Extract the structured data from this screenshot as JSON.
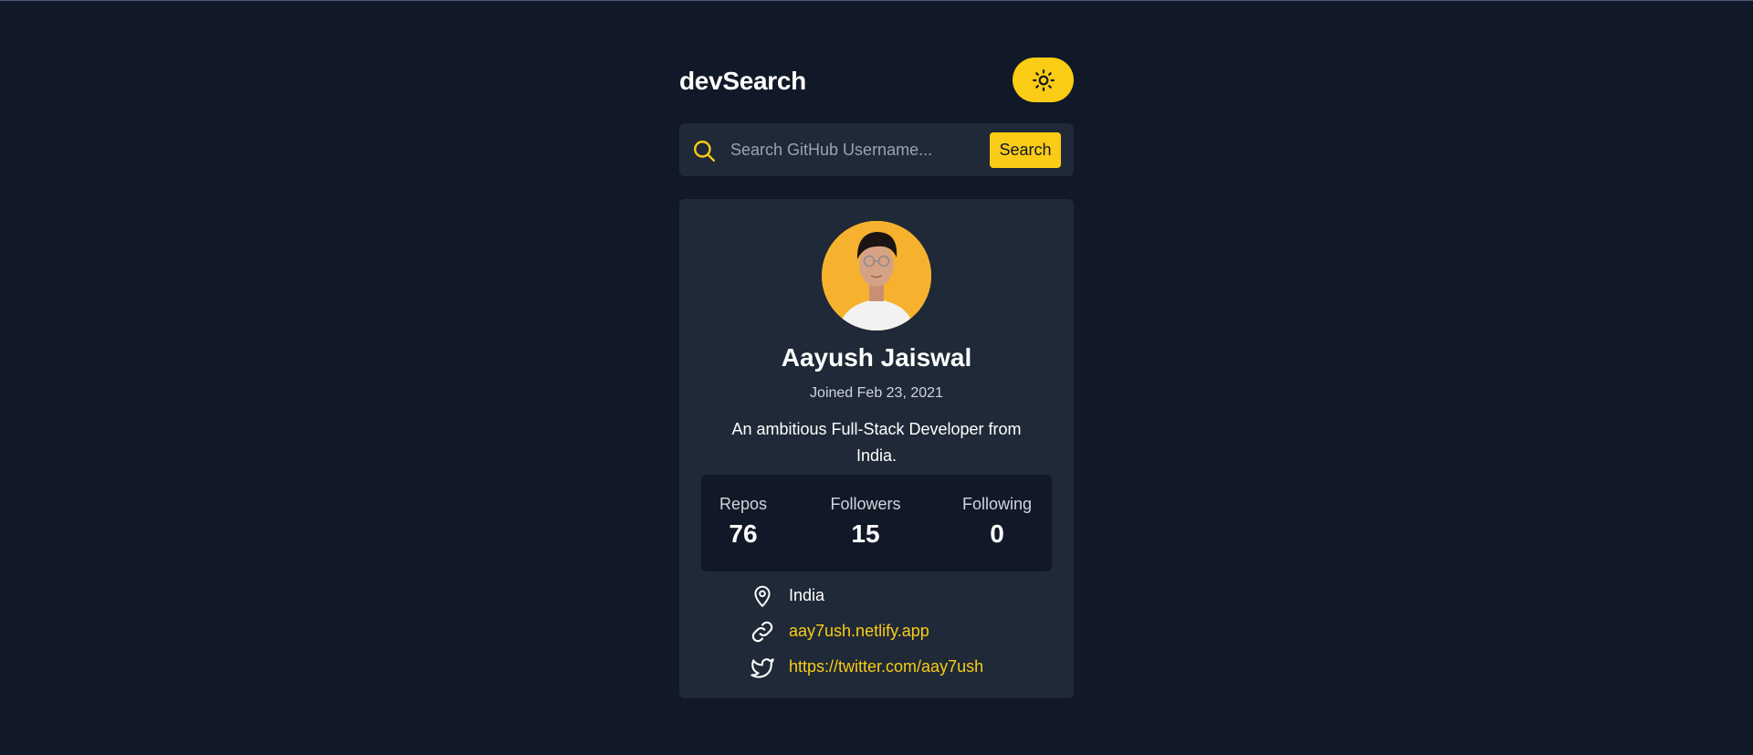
{
  "header": {
    "brand": "devSearch",
    "theme_toggle_icon": "sun-icon"
  },
  "search": {
    "placeholder": "Search GitHub Username...",
    "value": "",
    "button_label": "Search",
    "icon": "search-icon"
  },
  "profile": {
    "avatar": "avatar",
    "name": "Aayush Jaiswal",
    "joined": "Joined Feb 23, 2021",
    "bio": "An ambitious Full-Stack Developer from India."
  },
  "stats": [
    {
      "label": "Repos",
      "value": "76"
    },
    {
      "label": "Followers",
      "value": "15"
    },
    {
      "label": "Following",
      "value": "0"
    }
  ],
  "links": {
    "location": {
      "icon": "map-pin-icon",
      "text": "India"
    },
    "website": {
      "icon": "link-icon",
      "text": "aay7ush.netlify.app"
    },
    "twitter": {
      "icon": "twitter-icon",
      "text": "https://twitter.com/aay7ush"
    }
  },
  "colors": {
    "background": "#111827",
    "card": "#1f2937",
    "accent": "#facc15"
  }
}
